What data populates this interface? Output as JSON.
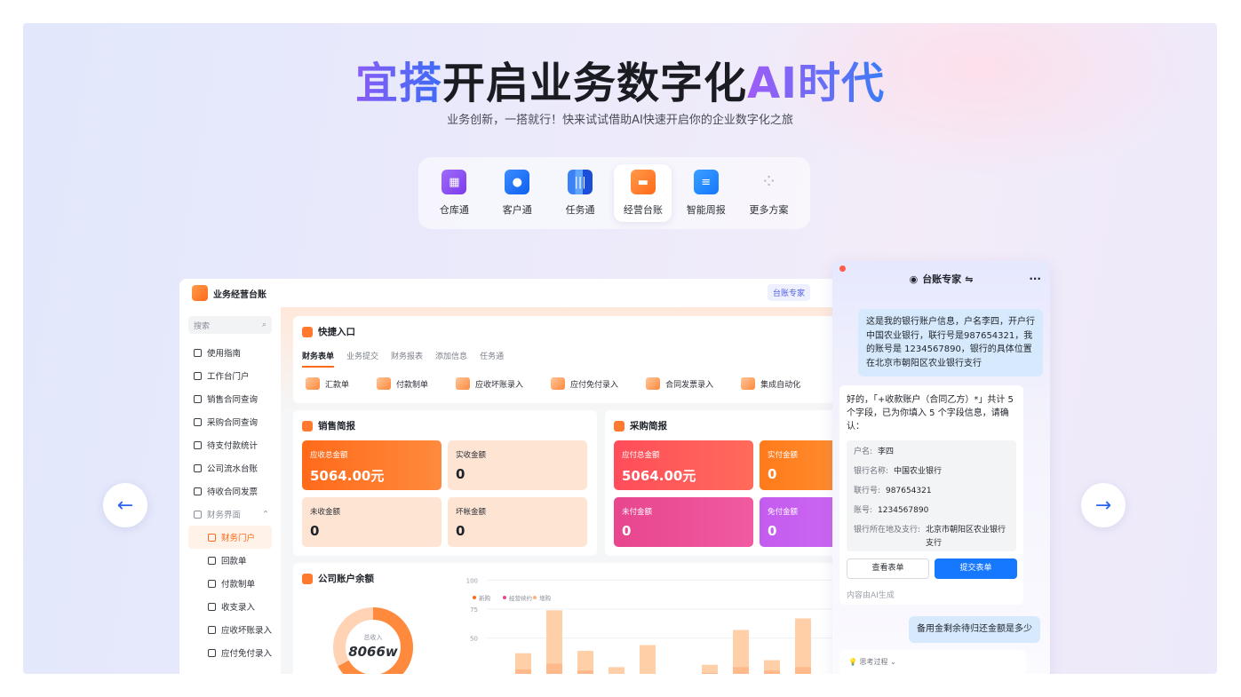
{
  "hero": {
    "title_a": "宜搭",
    "title_b": "开启业务数字化",
    "title_c": "AI时代",
    "subtitle": "业务创新，一搭就行！快来试试借助AI快速开启你的企业数字化之旅"
  },
  "tabs": [
    {
      "label": "仓库通",
      "icon": "warehouse-icon",
      "color": "#8b5cf6"
    },
    {
      "label": "客户通",
      "icon": "contact-icon",
      "color": "#1677ff"
    },
    {
      "label": "任务通",
      "icon": "books-icon",
      "color": "#3b82f6"
    },
    {
      "label": "经营台账",
      "icon": "wallet-icon",
      "color": "#ff7a1a"
    },
    {
      "label": "智能周报",
      "icon": "document-icon",
      "color": "#1e90ff"
    },
    {
      "label": "更多方案",
      "icon": "grid-icon",
      "color": "#c0c4cc"
    }
  ],
  "app": {
    "title": "业务经营台账",
    "expert_chip": "台账专家",
    "search_placeholder": "搜索",
    "sidebar": [
      "使用指南",
      "工作台门户",
      "销售合同查询",
      "采购合同查询",
      "待支付款统计",
      "公司流水台账",
      "待收合同发票"
    ],
    "group": "财务界面",
    "active_item": "财务门户",
    "subitems": [
      "回款单",
      "付款制单",
      "收支录入",
      "应收坏账录入",
      "应付免付录入"
    ],
    "quick": {
      "title": "快捷入口",
      "tabs": [
        "财务表单",
        "业务提交",
        "财务报表",
        "添加信息",
        "任务通"
      ],
      "items": [
        "汇款单",
        "付款制单",
        "应收坏账录入",
        "应付免付录入",
        "合同发票录入",
        "集成自动化"
      ]
    },
    "sales": {
      "title": "销售简报",
      "cards": [
        {
          "label": "应收总金额",
          "value": "5064.00元"
        },
        {
          "label": "实收金额",
          "value": "0"
        },
        {
          "label": "未收金额",
          "value": "0"
        },
        {
          "label": "坏帐金额",
          "value": "0"
        }
      ]
    },
    "purchase": {
      "title": "采购简报",
      "cards": [
        {
          "label": "应付总金额",
          "value": "5064.00元"
        },
        {
          "label": "实付金额",
          "value": "0"
        },
        {
          "label": "未付金额",
          "value": "0"
        },
        {
          "label": "免付金额",
          "value": "0"
        }
      ]
    },
    "balance": {
      "title": "公司账户余额",
      "donut_label": "总收入",
      "donut_value": "8066w",
      "legend": [
        "新购",
        "经营续约",
        "增购"
      ],
      "y_ticks": [
        "100",
        "75",
        "50"
      ]
    }
  },
  "chart_data": {
    "type": "bar",
    "title": "",
    "ylim": [
      0,
      100
    ],
    "series": [
      {
        "name": "新购",
        "values": [
          37,
          74,
          39,
          25,
          44,
          0,
          27,
          57,
          31,
          67
        ]
      },
      {
        "name": "经营续约",
        "values": [
          23,
          28,
          22,
          18,
          17,
          0,
          20,
          25,
          22,
          25
        ]
      }
    ]
  },
  "chat": {
    "title": "台账专家",
    "user_msg": "这是我的银行账户信息，户名李四，开户行中国农业银行，联行号是987654321，我的账号是 1234567890，银行的具体位置在北京市朝阳区农业银行支行",
    "ai_msg": "好的，「+收款账户（合同乙方）*」共计 5 个字段，已为你填入 5 个字段信息，请确认：",
    "fields": [
      {
        "k": "户名:",
        "v": "李四"
      },
      {
        "k": "银行名称:",
        "v": "中国农业银行"
      },
      {
        "k": "联行号:",
        "v": "987654321"
      },
      {
        "k": "账号:",
        "v": "1234567890"
      },
      {
        "k": "银行所在地及支行:",
        "v": "北京市朝阳区农业银行支行"
      }
    ],
    "view_btn": "查看表单",
    "submit_btn": "提交表单",
    "ai_note": "内容由AI生成",
    "user_msg2": "备用金剩余待归还金额是多少",
    "thinking": "思考过程"
  }
}
